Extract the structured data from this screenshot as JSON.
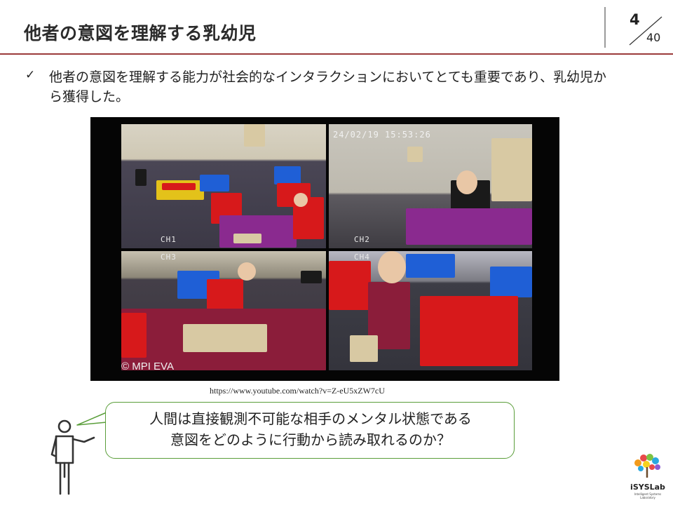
{
  "header": {
    "title": "他者の意図を理解する乳幼児",
    "page_current": "4",
    "page_total": "40"
  },
  "bullet": {
    "check_icon": "✓",
    "text": "他者の意図を理解する能力が社会的なインタラクションにおいてとても重要であり、乳幼児から獲得した。"
  },
  "video": {
    "timestamp": "24/02/19  15:53:26",
    "cameras": [
      "CH1",
      "CH2",
      "CH3",
      "CH4"
    ],
    "watermark": "© MPI EVA",
    "url": "https://www.youtube.com/watch?v=Z-eU5xZW7cU"
  },
  "speech": {
    "line1": "人間は直接観測不可能な相手のメンタル状態である",
    "line2": "意図をどのように行動から読み取れるのか？"
  },
  "logo": {
    "name": "iSYSLab",
    "subtitle": "Intelligent Systems Laboratory"
  },
  "colors": {
    "title_rule": "#9b3b3b",
    "bubble_border": "#5a9e3a"
  },
  "icons": {
    "speaker": "presenter-figure-icon",
    "check": "checkmark-icon"
  }
}
